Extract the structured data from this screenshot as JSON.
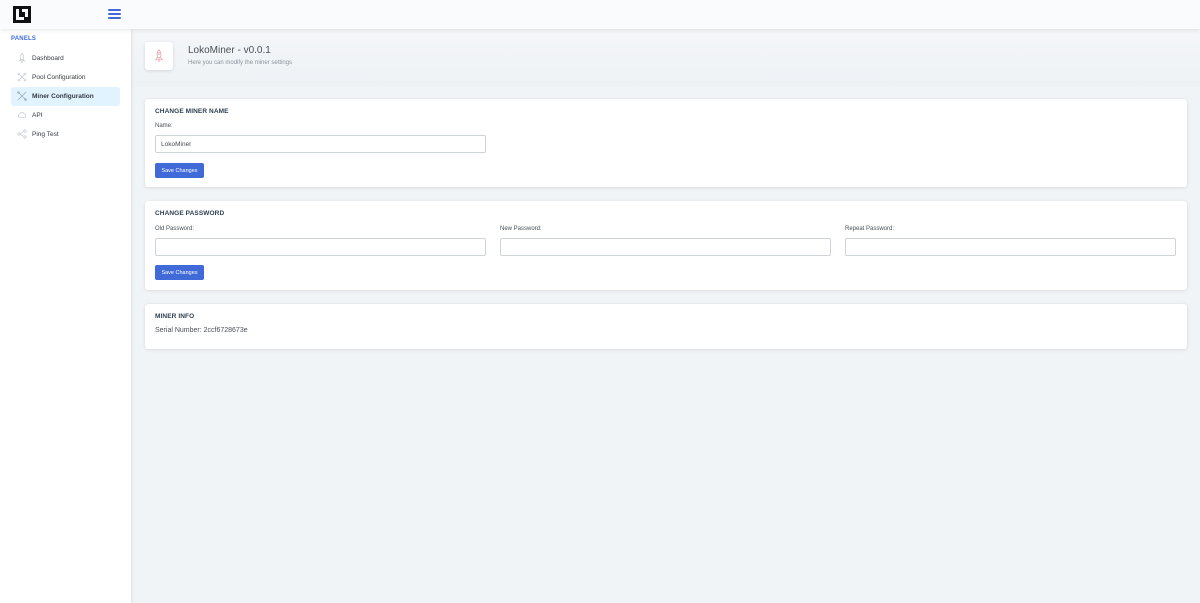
{
  "header": {
    "logo_icon": "logo-icon",
    "menu_icon": "hamburger-menu-icon"
  },
  "sidebar": {
    "heading": "PANELS",
    "items": [
      {
        "label": "Dashboard",
        "icon": "rocket-icon",
        "active": false
      },
      {
        "label": "Pool Configuration",
        "icon": "network-icon",
        "active": false
      },
      {
        "label": "Miner Configuration",
        "icon": "tools-icon",
        "active": true
      },
      {
        "label": "API",
        "icon": "cloud-icon",
        "active": false
      },
      {
        "label": "Ping Test",
        "icon": "share-icon",
        "active": false
      }
    ]
  },
  "page": {
    "title": "LokoMiner - v0.0.1",
    "subtitle": "Here you can modify the miner settings",
    "icon": "rocket-icon"
  },
  "change_name": {
    "title": "CHANGE MINER NAME",
    "name_label": "Name:",
    "name_value": "LokoMiner",
    "save_label": "Save Changes"
  },
  "change_password": {
    "title": "CHANGE PASSWORD",
    "old_label": "Old Password:",
    "new_label": "New Password:",
    "repeat_label": "Repeat Password:",
    "old_value": "",
    "new_value": "",
    "repeat_value": "",
    "save_label": "Save Changes"
  },
  "miner_info": {
    "title": "MINER INFO",
    "serial_text": "Serial Number: 2ccf6728673e"
  },
  "colors": {
    "accent": "#3f6ad8",
    "active_nav_bg": "#e0f3ff",
    "background": "#f1f4f6"
  }
}
